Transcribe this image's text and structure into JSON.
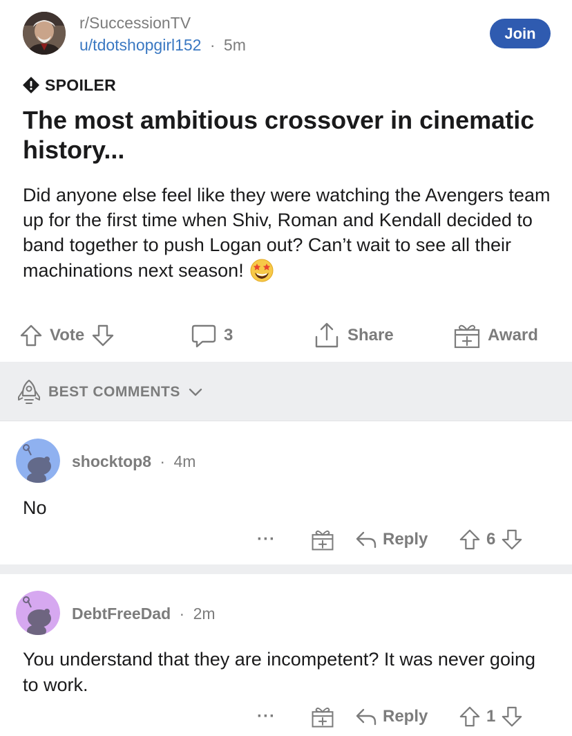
{
  "post": {
    "subreddit": "r/SuccessionTV",
    "author": "u/tdotshopgirl152",
    "separator": "·",
    "age": "5m",
    "join_label": "Join",
    "spoiler_label": "SPOILER",
    "title": "The most ambitious crossover in cinematic history...",
    "body": "Did anyone else feel like they were watching the Avengers team up for the first time when Shiv, Roman and Kendall decided to band together to push Logan out? Can’t wait to see all their machinations next season!",
    "emoji": "star-struck-emoji",
    "actions": {
      "vote_label": "Vote",
      "comment_count": "3",
      "share_label": "Share",
      "award_label": "Award"
    }
  },
  "sort": {
    "label": "BEST COMMENTS"
  },
  "comments": [
    {
      "username": "shocktop8",
      "separator": "·",
      "age": "4m",
      "body": "No",
      "more": "···",
      "reply_label": "Reply",
      "score": "6",
      "avatar_color": "#8fb1f0"
    },
    {
      "username": "DebtFreeDad",
      "separator": "·",
      "age": "2m",
      "body": "You understand that they are incompetent? It was never going to work.",
      "more": "···",
      "reply_label": "Reply",
      "score": "1",
      "avatar_color": "#d6a8f0"
    }
  ],
  "colors": {
    "join_button": "#2f5bb0",
    "link_blue": "#3a78c2",
    "meta_gray": "#7c7c7c",
    "divider_gray": "#edeef0"
  }
}
